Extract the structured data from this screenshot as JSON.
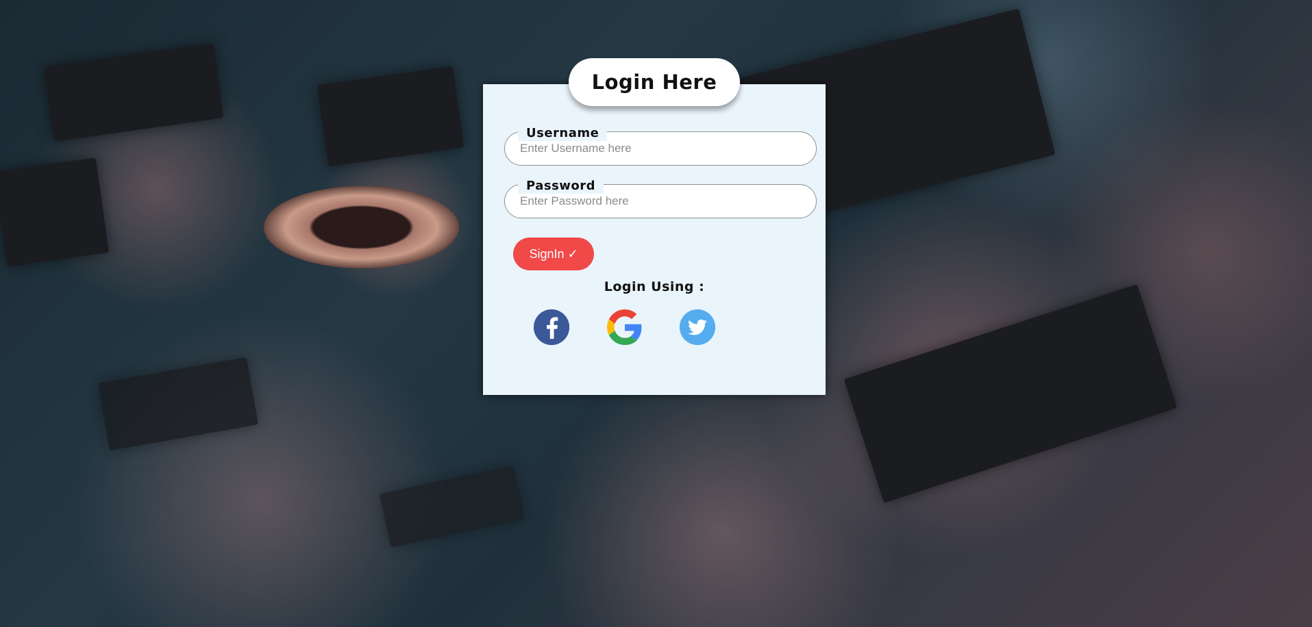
{
  "login": {
    "title": "Login Here",
    "username": {
      "label": "Username",
      "placeholder": "Enter Username here",
      "value": ""
    },
    "password": {
      "label": "Password",
      "placeholder": "Enter Password here",
      "value": ""
    },
    "signin_label": "SignIn ✓",
    "login_using_label": "Login Using :",
    "social": [
      {
        "name": "facebook",
        "icon": "facebook-icon",
        "color": "#3b5998"
      },
      {
        "name": "google",
        "icon": "google-icon",
        "color": "#4285f4"
      },
      {
        "name": "twitter",
        "icon": "twitter-icon",
        "color": "#55acee"
      }
    ]
  },
  "colors": {
    "card_bg": "#eaf4fb",
    "signin_bg": "#f14848",
    "text": "#111111"
  }
}
